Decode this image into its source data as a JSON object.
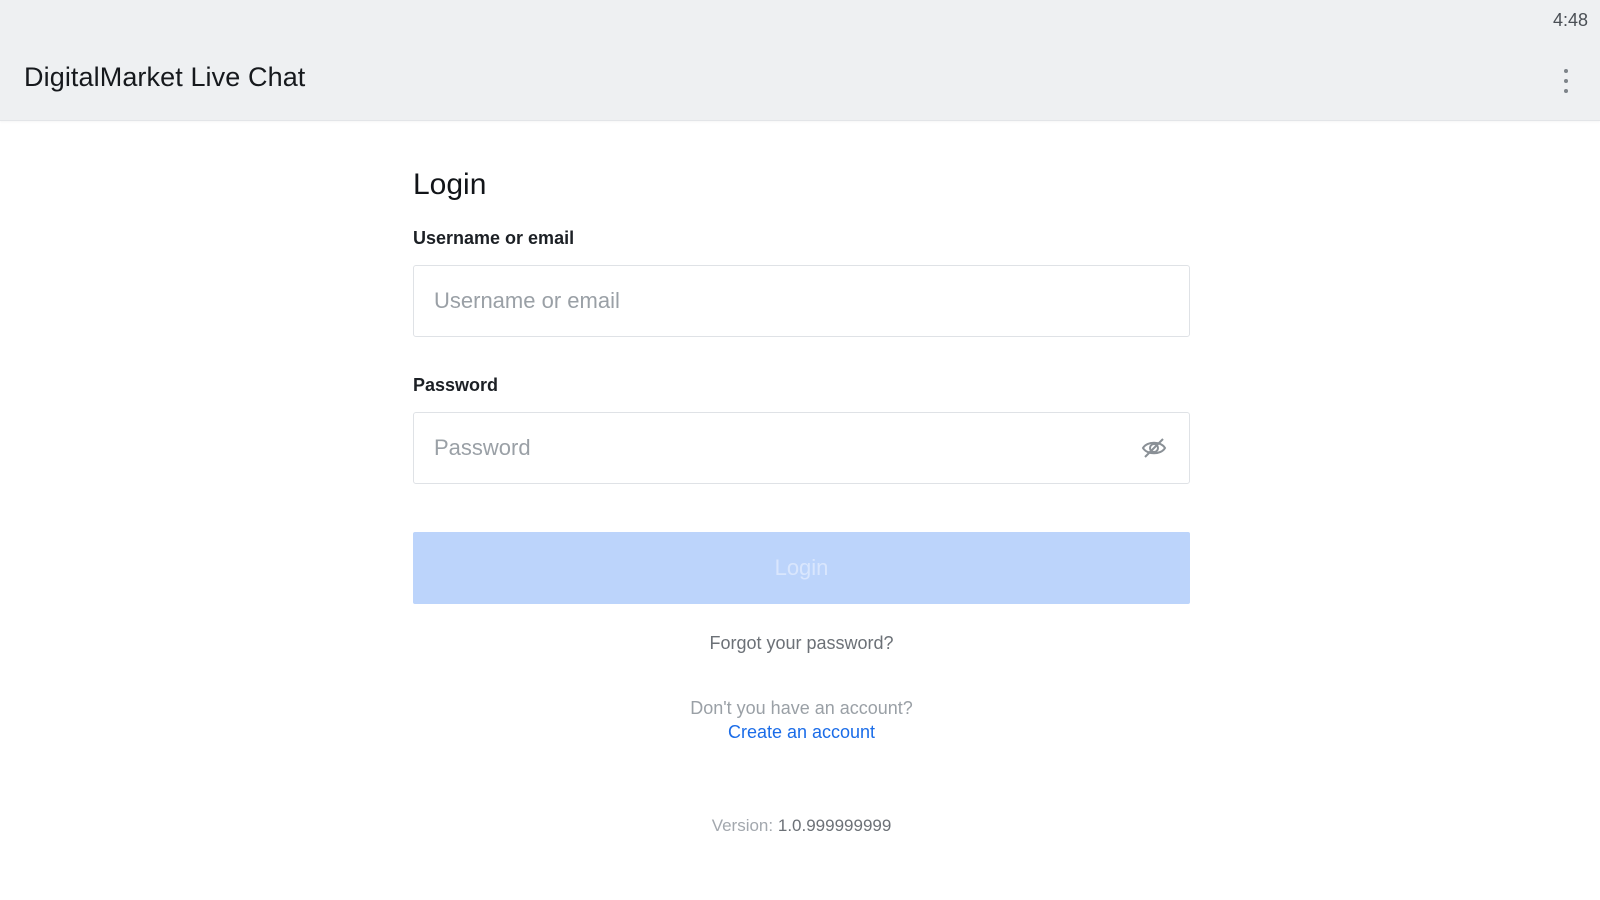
{
  "status_bar": {
    "time": "4:48"
  },
  "app_bar": {
    "title": "DigitalMarket Live Chat",
    "menu_icon": "more-vert-icon"
  },
  "login_form": {
    "title": "Login",
    "username": {
      "label": "Username or email",
      "placeholder": "Username or email",
      "value": ""
    },
    "password": {
      "label": "Password",
      "placeholder": "Password",
      "value": "",
      "toggle_icon": "eye-off-icon"
    },
    "submit_label": "Login",
    "forgot_password": "Forgot your password?",
    "no_account_prompt": "Don't you have an account?",
    "create_account": "Create an account",
    "version_label": "Version:",
    "version_value": "1.0.999999999"
  },
  "colors": {
    "app_bar_bg": "#eef0f2",
    "button_disabled_bg": "#bcd4fb",
    "link": "#1a6ce8"
  }
}
